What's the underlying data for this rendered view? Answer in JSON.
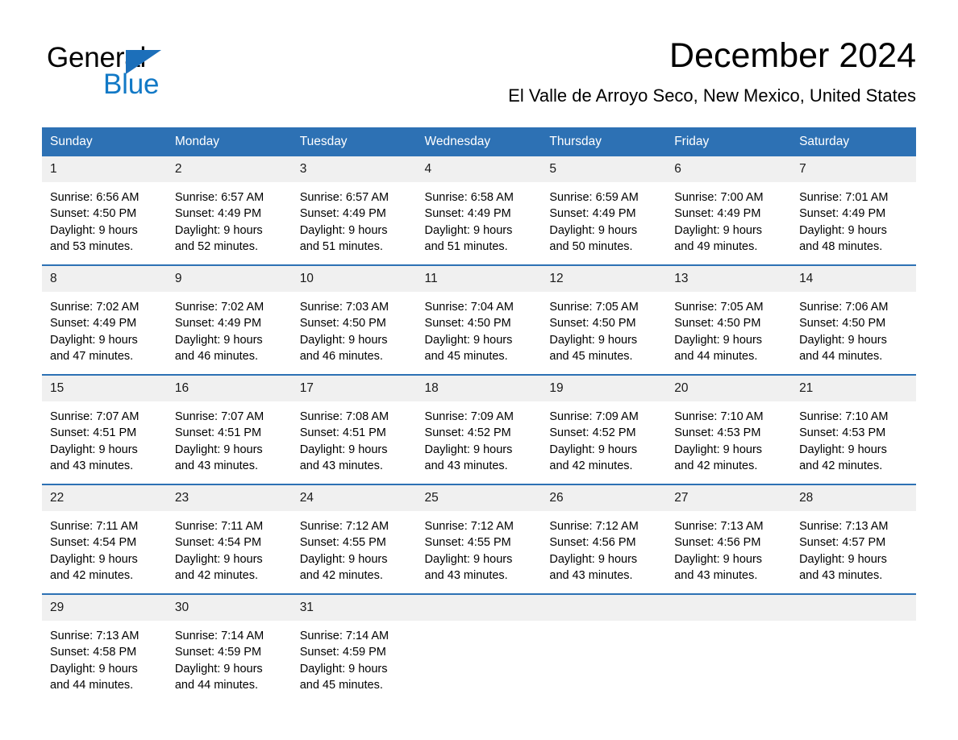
{
  "brand": {
    "name_part1": "General",
    "name_part2": "Blue",
    "triangle_color": "#1c6fba",
    "blue_color": "#1279c6"
  },
  "header": {
    "title": "December 2024",
    "subtitle": "El Valle de Arroyo Seco, New Mexico, United States"
  },
  "theme": {
    "header_blue": "#2d71b4",
    "daynum_band": "#f0f0f0",
    "text": "#000000"
  },
  "calendar": {
    "weekday_headers": [
      "Sunday",
      "Monday",
      "Tuesday",
      "Wednesday",
      "Thursday",
      "Friday",
      "Saturday"
    ],
    "weeks": [
      [
        {
          "day": "1",
          "sunrise": "Sunrise: 6:56 AM",
          "sunset": "Sunset: 4:50 PM",
          "daylight_line1": "Daylight: 9 hours",
          "daylight_line2": "and 53 minutes."
        },
        {
          "day": "2",
          "sunrise": "Sunrise: 6:57 AM",
          "sunset": "Sunset: 4:49 PM",
          "daylight_line1": "Daylight: 9 hours",
          "daylight_line2": "and 52 minutes."
        },
        {
          "day": "3",
          "sunrise": "Sunrise: 6:57 AM",
          "sunset": "Sunset: 4:49 PM",
          "daylight_line1": "Daylight: 9 hours",
          "daylight_line2": "and 51 minutes."
        },
        {
          "day": "4",
          "sunrise": "Sunrise: 6:58 AM",
          "sunset": "Sunset: 4:49 PM",
          "daylight_line1": "Daylight: 9 hours",
          "daylight_line2": "and 51 minutes."
        },
        {
          "day": "5",
          "sunrise": "Sunrise: 6:59 AM",
          "sunset": "Sunset: 4:49 PM",
          "daylight_line1": "Daylight: 9 hours",
          "daylight_line2": "and 50 minutes."
        },
        {
          "day": "6",
          "sunrise": "Sunrise: 7:00 AM",
          "sunset": "Sunset: 4:49 PM",
          "daylight_line1": "Daylight: 9 hours",
          "daylight_line2": "and 49 minutes."
        },
        {
          "day": "7",
          "sunrise": "Sunrise: 7:01 AM",
          "sunset": "Sunset: 4:49 PM",
          "daylight_line1": "Daylight: 9 hours",
          "daylight_line2": "and 48 minutes."
        }
      ],
      [
        {
          "day": "8",
          "sunrise": "Sunrise: 7:02 AM",
          "sunset": "Sunset: 4:49 PM",
          "daylight_line1": "Daylight: 9 hours",
          "daylight_line2": "and 47 minutes."
        },
        {
          "day": "9",
          "sunrise": "Sunrise: 7:02 AM",
          "sunset": "Sunset: 4:49 PM",
          "daylight_line1": "Daylight: 9 hours",
          "daylight_line2": "and 46 minutes."
        },
        {
          "day": "10",
          "sunrise": "Sunrise: 7:03 AM",
          "sunset": "Sunset: 4:50 PM",
          "daylight_line1": "Daylight: 9 hours",
          "daylight_line2": "and 46 minutes."
        },
        {
          "day": "11",
          "sunrise": "Sunrise: 7:04 AM",
          "sunset": "Sunset: 4:50 PM",
          "daylight_line1": "Daylight: 9 hours",
          "daylight_line2": "and 45 minutes."
        },
        {
          "day": "12",
          "sunrise": "Sunrise: 7:05 AM",
          "sunset": "Sunset: 4:50 PM",
          "daylight_line1": "Daylight: 9 hours",
          "daylight_line2": "and 45 minutes."
        },
        {
          "day": "13",
          "sunrise": "Sunrise: 7:05 AM",
          "sunset": "Sunset: 4:50 PM",
          "daylight_line1": "Daylight: 9 hours",
          "daylight_line2": "and 44 minutes."
        },
        {
          "day": "14",
          "sunrise": "Sunrise: 7:06 AM",
          "sunset": "Sunset: 4:50 PM",
          "daylight_line1": "Daylight: 9 hours",
          "daylight_line2": "and 44 minutes."
        }
      ],
      [
        {
          "day": "15",
          "sunrise": "Sunrise: 7:07 AM",
          "sunset": "Sunset: 4:51 PM",
          "daylight_line1": "Daylight: 9 hours",
          "daylight_line2": "and 43 minutes."
        },
        {
          "day": "16",
          "sunrise": "Sunrise: 7:07 AM",
          "sunset": "Sunset: 4:51 PM",
          "daylight_line1": "Daylight: 9 hours",
          "daylight_line2": "and 43 minutes."
        },
        {
          "day": "17",
          "sunrise": "Sunrise: 7:08 AM",
          "sunset": "Sunset: 4:51 PM",
          "daylight_line1": "Daylight: 9 hours",
          "daylight_line2": "and 43 minutes."
        },
        {
          "day": "18",
          "sunrise": "Sunrise: 7:09 AM",
          "sunset": "Sunset: 4:52 PM",
          "daylight_line1": "Daylight: 9 hours",
          "daylight_line2": "and 43 minutes."
        },
        {
          "day": "19",
          "sunrise": "Sunrise: 7:09 AM",
          "sunset": "Sunset: 4:52 PM",
          "daylight_line1": "Daylight: 9 hours",
          "daylight_line2": "and 42 minutes."
        },
        {
          "day": "20",
          "sunrise": "Sunrise: 7:10 AM",
          "sunset": "Sunset: 4:53 PM",
          "daylight_line1": "Daylight: 9 hours",
          "daylight_line2": "and 42 minutes."
        },
        {
          "day": "21",
          "sunrise": "Sunrise: 7:10 AM",
          "sunset": "Sunset: 4:53 PM",
          "daylight_line1": "Daylight: 9 hours",
          "daylight_line2": "and 42 minutes."
        }
      ],
      [
        {
          "day": "22",
          "sunrise": "Sunrise: 7:11 AM",
          "sunset": "Sunset: 4:54 PM",
          "daylight_line1": "Daylight: 9 hours",
          "daylight_line2": "and 42 minutes."
        },
        {
          "day": "23",
          "sunrise": "Sunrise: 7:11 AM",
          "sunset": "Sunset: 4:54 PM",
          "daylight_line1": "Daylight: 9 hours",
          "daylight_line2": "and 42 minutes."
        },
        {
          "day": "24",
          "sunrise": "Sunrise: 7:12 AM",
          "sunset": "Sunset: 4:55 PM",
          "daylight_line1": "Daylight: 9 hours",
          "daylight_line2": "and 42 minutes."
        },
        {
          "day": "25",
          "sunrise": "Sunrise: 7:12 AM",
          "sunset": "Sunset: 4:55 PM",
          "daylight_line1": "Daylight: 9 hours",
          "daylight_line2": "and 43 minutes."
        },
        {
          "day": "26",
          "sunrise": "Sunrise: 7:12 AM",
          "sunset": "Sunset: 4:56 PM",
          "daylight_line1": "Daylight: 9 hours",
          "daylight_line2": "and 43 minutes."
        },
        {
          "day": "27",
          "sunrise": "Sunrise: 7:13 AM",
          "sunset": "Sunset: 4:56 PM",
          "daylight_line1": "Daylight: 9 hours",
          "daylight_line2": "and 43 minutes."
        },
        {
          "day": "28",
          "sunrise": "Sunrise: 7:13 AM",
          "sunset": "Sunset: 4:57 PM",
          "daylight_line1": "Daylight: 9 hours",
          "daylight_line2": "and 43 minutes."
        }
      ],
      [
        {
          "day": "29",
          "sunrise": "Sunrise: 7:13 AM",
          "sunset": "Sunset: 4:58 PM",
          "daylight_line1": "Daylight: 9 hours",
          "daylight_line2": "and 44 minutes."
        },
        {
          "day": "30",
          "sunrise": "Sunrise: 7:14 AM",
          "sunset": "Sunset: 4:59 PM",
          "daylight_line1": "Daylight: 9 hours",
          "daylight_line2": "and 44 minutes."
        },
        {
          "day": "31",
          "sunrise": "Sunrise: 7:14 AM",
          "sunset": "Sunset: 4:59 PM",
          "daylight_line1": "Daylight: 9 hours",
          "daylight_line2": "and 45 minutes."
        },
        {
          "day": "",
          "sunrise": "",
          "sunset": "",
          "daylight_line1": "",
          "daylight_line2": ""
        },
        {
          "day": "",
          "sunrise": "",
          "sunset": "",
          "daylight_line1": "",
          "daylight_line2": ""
        },
        {
          "day": "",
          "sunrise": "",
          "sunset": "",
          "daylight_line1": "",
          "daylight_line2": ""
        },
        {
          "day": "",
          "sunrise": "",
          "sunset": "",
          "daylight_line1": "",
          "daylight_line2": ""
        }
      ]
    ]
  }
}
